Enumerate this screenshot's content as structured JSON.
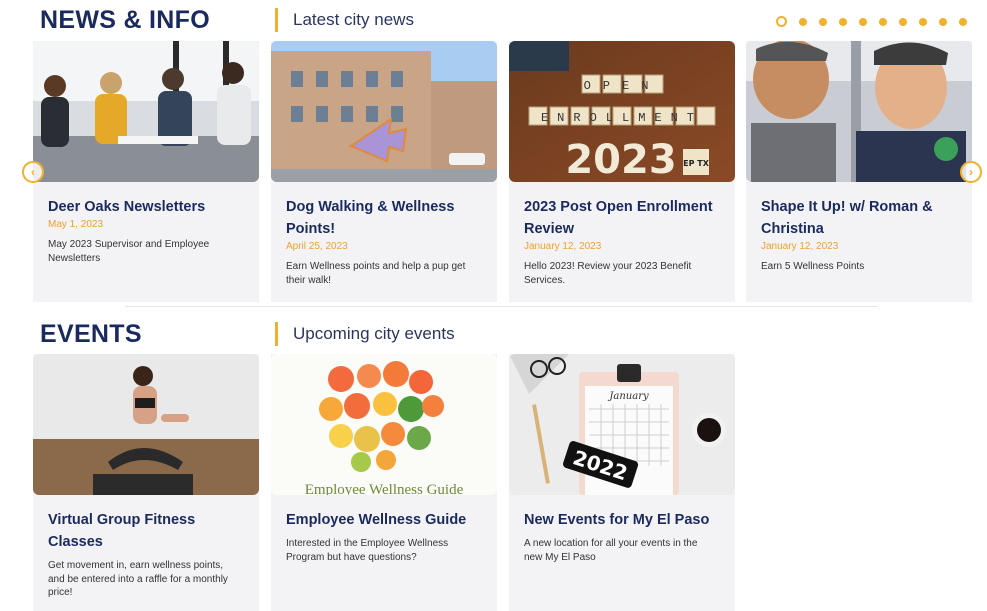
{
  "news": {
    "title": "NEWS & INFO",
    "subtitle": "Latest city news",
    "cards": [
      {
        "title_1": "Deer Oaks Newsletters",
        "title_2": "",
        "date": "May 1, 2023",
        "desc_1": "May 2023 Supervisor and Employee",
        "desc_2": "Newsletters",
        "desc_3": ""
      },
      {
        "title_1": "Dog Walking & Wellness",
        "title_2": "Points!",
        "date": "April 25, 2023",
        "desc_1": "Earn Wellness points and help a pup get",
        "desc_2": "their walk!",
        "desc_3": ""
      },
      {
        "title_1": "2023 Post Open Enrollment",
        "title_2": "Review",
        "date": "January 12, 2023",
        "desc_1": "Hello 2023! Review your 2023 Benefit",
        "desc_2": "Services.",
        "desc_3": ""
      },
      {
        "title_1": "Shape It Up! w/ Roman &",
        "title_2": "Christina",
        "date": "January 12, 2023",
        "desc_1": "Earn 5 Wellness Points",
        "desc_2": "",
        "desc_3": ""
      }
    ],
    "image_text": {
      "open": "OPEN",
      "enrollment": "ENROLLMENT",
      "year": "2023",
      "badge": "EP TX"
    }
  },
  "events": {
    "title": "EVENTS",
    "subtitle": "Upcoming city events",
    "cards": [
      {
        "title_1": "Virtual Group Fitness",
        "title_2": "Classes",
        "desc_1": "Get movement in, earn wellness points,",
        "desc_2": "and be entered into a raffle for a monthly",
        "desc_3": "price!"
      },
      {
        "title_1": "Employee Wellness Guide",
        "title_2": "",
        "desc_1": "Interested in the Employee Wellness",
        "desc_2": "Program but have questions?",
        "desc_3": ""
      },
      {
        "title_1": "New Events for My El Paso",
        "title_2": "",
        "desc_1": "A new location for all your events in the",
        "desc_2": "new My El Paso",
        "desc_3": ""
      }
    ],
    "image_text": {
      "guide": "Employee Wellness Guide",
      "year": "2022",
      "month": "January"
    }
  },
  "carousel": {
    "prev_icon": "chevron-left-icon",
    "next_icon": "chevron-right-icon",
    "dot_count": 10,
    "active_dot": 0
  },
  "colors": {
    "accent": "#f0b030",
    "heading": "#1b2a5e",
    "card_bg": "#f3f3f5",
    "date": "#f0a030"
  }
}
